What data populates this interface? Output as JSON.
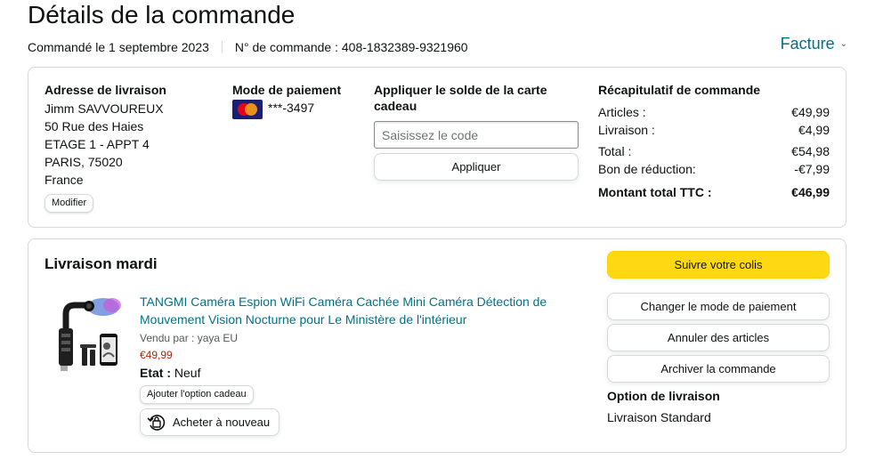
{
  "header": {
    "title": "Détails de la commande",
    "ordered_on": "Commandé le 1 septembre 2023",
    "order_number": "N° de commande : 408-1832389-9321960",
    "invoice_label": "Facture"
  },
  "address": {
    "heading": "Adresse de livraison",
    "lines": [
      "Jimm SAVVOUREUX",
      "50 Rue des Haies",
      "ETAGE 1 - APPT 4",
      "PARIS, 75020",
      "France"
    ],
    "modify_label": "Modifier"
  },
  "payment": {
    "heading": "Mode de paiement",
    "card_icon": "mastercard-icon",
    "card_number": "***-3497"
  },
  "gift_card": {
    "heading": "Appliquer le solde de la carte cadeau",
    "placeholder": "Saisissez le code",
    "apply_label": "Appliquer"
  },
  "summary": {
    "heading": "Récapitulatif de commande",
    "rows": [
      {
        "label": "Articles :",
        "value": "€49,99"
      },
      {
        "label": "Livraison :",
        "value": "€4,99"
      },
      {
        "label": "Total :",
        "value": "€54,98"
      },
      {
        "label": "Bon de réduction:",
        "value": "-€7,99"
      }
    ],
    "grand_total_label": "Montant total TTC :",
    "grand_total_value": "€46,99"
  },
  "shipment": {
    "heading": "Livraison mardi",
    "product_image_icon": "spy-camera-product-image",
    "product_title": "TANGMI Caméra Espion WiFi Caméra Cachée Mini Caméra Détection de Mouvement Vision Nocturne pour Le Ministère de l'intérieur",
    "seller": "Vendu par : yaya EU",
    "price": "€49,99",
    "state_label": "Etat :",
    "state_value": "Neuf",
    "gift_option_label": "Ajouter l'option cadeau",
    "rebuy_label": "Acheter à nouveau"
  },
  "actions": {
    "track": "Suivre votre colis",
    "change_payment": "Changer le mode de paiement",
    "cancel_items": "Annuler des articles",
    "archive": "Archiver la commande",
    "delivery_option_heading": "Option de livraison",
    "delivery_option_value": "Livraison Standard"
  },
  "colors": {
    "link": "#007185",
    "primary_button": "#ffd814",
    "price": "#b12704",
    "border": "#d5d9d9"
  }
}
